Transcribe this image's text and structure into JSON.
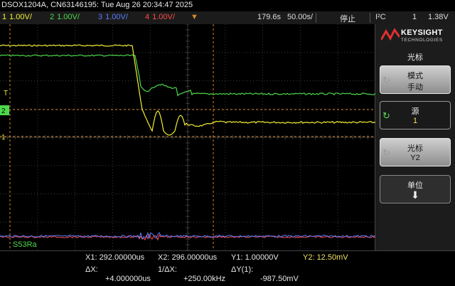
{
  "window_title": "DSOX1204A, CN63146195: Tue Aug 26 20:34:47 2025",
  "channels": [
    {
      "num": "1",
      "scale": "1.00V/",
      "color": "#f2f032"
    },
    {
      "num": "2",
      "scale": "1.00V/",
      "color": "#4cd94c"
    },
    {
      "num": "3",
      "scale": "1.00V/",
      "color": "#5a7dff"
    },
    {
      "num": "4",
      "scale": "1.00V/",
      "color": "#ff4a4a"
    }
  ],
  "timebase": {
    "delay": "179.6s",
    "scale": "50.00s/"
  },
  "run_state": "停止",
  "trigger": {
    "type": "I²C",
    "source": "1",
    "level": "1.38V"
  },
  "brand": {
    "name": "KEYSIGHT",
    "sub": "TECHNOLOGIES"
  },
  "menu": {
    "title": "光标",
    "softkeys": [
      {
        "label": "模式",
        "value": "手动"
      },
      {
        "label": "源",
        "value": "1"
      },
      {
        "label": "光标",
        "value": "Y2"
      },
      {
        "label": "单位",
        "value": "⬇"
      }
    ]
  },
  "decode_label": "S53Ra",
  "cursor_readout": {
    "x1": "X1:  292.00000us",
    "x2": "X2:  296.00000us",
    "y1": "Y1:  1.00000V",
    "y2": "Y2:  12.50mV",
    "dx_label": "ΔX:",
    "dx_value": "+4.000000us",
    "inv_dx_label": "1/ΔX:",
    "inv_dx_value": "+250.00kHz",
    "dy_label": "ΔY(1):",
    "dy_value": "-987.50mV"
  },
  "colors": {
    "cursor": "#d4892a",
    "grid": "#3a3a3a",
    "ground_marker": "#4cd94c"
  }
}
